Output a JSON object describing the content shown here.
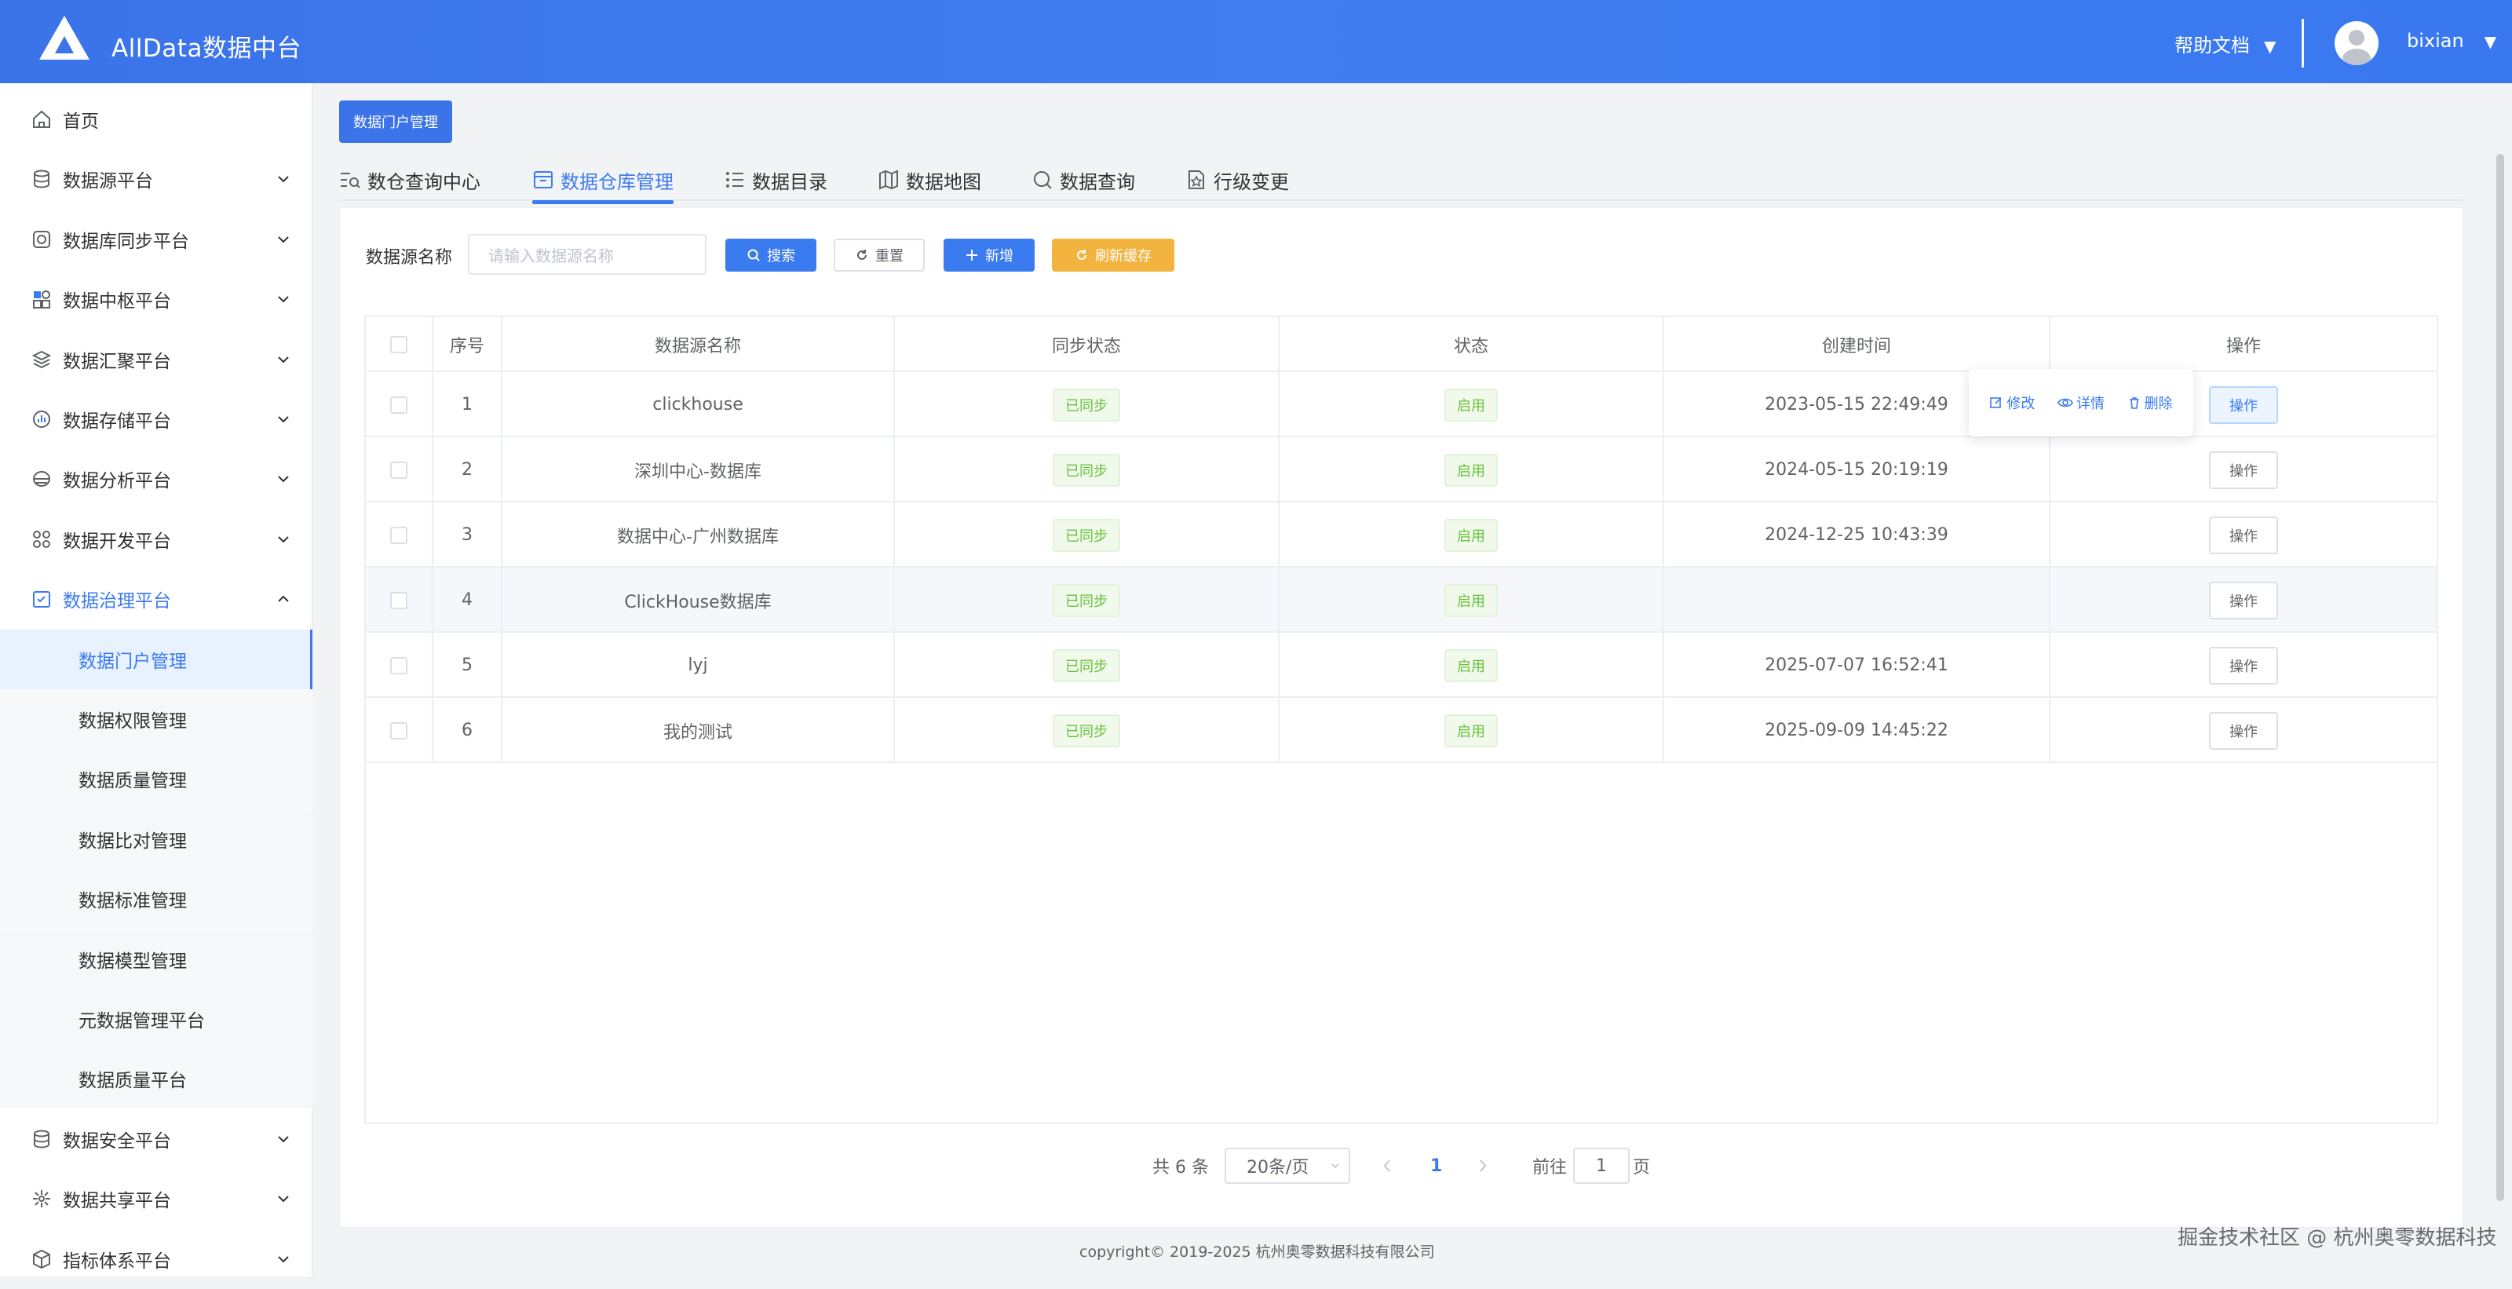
{
  "header": {
    "title": "AllData数据中台",
    "help": "帮助文档",
    "caret": "▼",
    "user": "bixian"
  },
  "sidebar": {
    "items": [
      {
        "label": "首页",
        "icon": "home-icon"
      },
      {
        "label": "数据源平台",
        "icon": "database-icon"
      },
      {
        "label": "数据库同步平台",
        "icon": "sync-icon"
      },
      {
        "label": "数据中枢平台",
        "icon": "grid-icon"
      },
      {
        "label": "数据汇聚平台",
        "icon": "layers-icon"
      },
      {
        "label": "数据存储平台",
        "icon": "storage-chart-icon"
      },
      {
        "label": "数据分析平台",
        "icon": "analysis-icon"
      },
      {
        "label": "数据开发平台",
        "icon": "apps-icon"
      },
      {
        "label": "数据治理平台",
        "icon": "governance-icon"
      },
      {
        "label": "数据门户管理",
        "sub": true
      },
      {
        "label": "数据权限管理",
        "sub": true
      },
      {
        "label": "数据质量管理",
        "sub": true
      },
      {
        "label": "数据比对管理",
        "sub": true
      },
      {
        "label": "数据标准管理",
        "sub": true
      },
      {
        "label": "数据模型管理",
        "sub": true
      },
      {
        "label": "元数据管理平台",
        "sub": true
      },
      {
        "label": "数据质量平台",
        "sub": true
      },
      {
        "label": "数据安全平台",
        "icon": "security-icon"
      },
      {
        "label": "数据共享平台",
        "icon": "share-icon"
      },
      {
        "label": "指标体系平台",
        "icon": "metrics-icon"
      }
    ]
  },
  "breadcrumb_tag": "数据门户管理",
  "tabs": [
    {
      "label": "数仓查询中心",
      "icon": "search-list-icon"
    },
    {
      "label": "数据仓库管理",
      "icon": "warehouse-icon",
      "active": true
    },
    {
      "label": "数据目录",
      "icon": "list-icon"
    },
    {
      "label": "数据地图",
      "icon": "map-icon"
    },
    {
      "label": "数据查询",
      "icon": "query-icon"
    },
    {
      "label": "行级变更",
      "icon": "change-icon"
    }
  ],
  "search": {
    "label": "数据源名称",
    "placeholder": "请输入数据源名称"
  },
  "buttons": {
    "search": "搜索",
    "reset": "重置",
    "add": "新增",
    "refresh": "刷新缓存"
  },
  "table": {
    "headers": [
      "序号",
      "数据源名称",
      "同步状态",
      "状态",
      "创建时间",
      "操作"
    ],
    "rows": [
      {
        "no": "1",
        "name": "clickhouse",
        "sync": "已同步",
        "status": "启用",
        "created": "2023-05-15 22:49:49",
        "op": "操作"
      },
      {
        "no": "2",
        "name": "深圳中心-数据库",
        "sync": "已同步",
        "status": "启用",
        "created": "2024-05-15 20:19:19",
        "op": "操作"
      },
      {
        "no": "3",
        "name": "数据中心-广州数据库",
        "sync": "已同步",
        "status": "启用",
        "created": "2024-12-25 10:43:39",
        "op": "操作"
      },
      {
        "no": "4",
        "name": "ClickHouse数据库",
        "sync": "已同步",
        "status": "启用",
        "created": "",
        "op": "操作"
      },
      {
        "no": "5",
        "name": "lyj",
        "sync": "已同步",
        "status": "启用",
        "created": "2025-07-07 16:52:41",
        "op": "操作"
      },
      {
        "no": "6",
        "name": "我的测试",
        "sync": "已同步",
        "status": "启用",
        "created": "2025-09-09 14:45:22",
        "op": "操作"
      }
    ]
  },
  "popover": {
    "edit": "修改",
    "detail": "详情",
    "delete": "删除"
  },
  "pagination": {
    "total": "共 6 条",
    "size": "20条/页",
    "current": "1",
    "goto": "前往",
    "page_suffix": "页",
    "jump_value": "1"
  },
  "footer": "copyright© 2019-2025 杭州奥零数据科技有限公司",
  "watermark": "掘金技术社区 @ 杭州奥零数据科技",
  "colors": {
    "primary": "#3b7bf0",
    "warning": "#f3b33f",
    "success": "#67c23a"
  }
}
